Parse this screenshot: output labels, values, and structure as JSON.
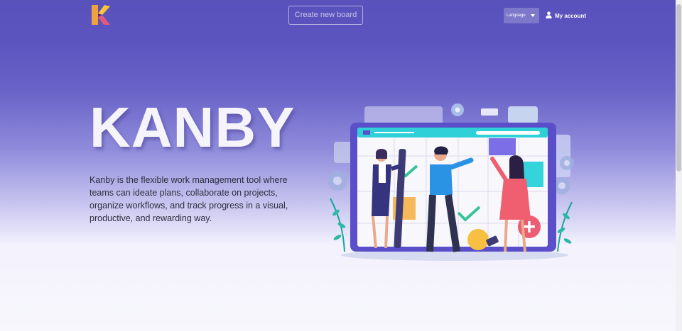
{
  "header": {
    "logo_letter": "K",
    "create_board_label": "Create new board",
    "language_label": "Language",
    "account_label": "My account"
  },
  "hero": {
    "title": "KANBY",
    "description": "Kanby is the flexible work management tool where teams can ideate plans, collaborate on projects, organize workflows, and track progress in a visual, productive, and rewarding way."
  },
  "icons": {
    "logo": "kanby-logo-icon",
    "account": "user-icon",
    "caret": "caret-down-icon"
  },
  "colors": {
    "primary": "#5a52bb",
    "text": "#2d2f3e",
    "board_frame": "#5a4fc8",
    "accent_teal": "#2fd0d8",
    "check_green": "#39c39b"
  }
}
